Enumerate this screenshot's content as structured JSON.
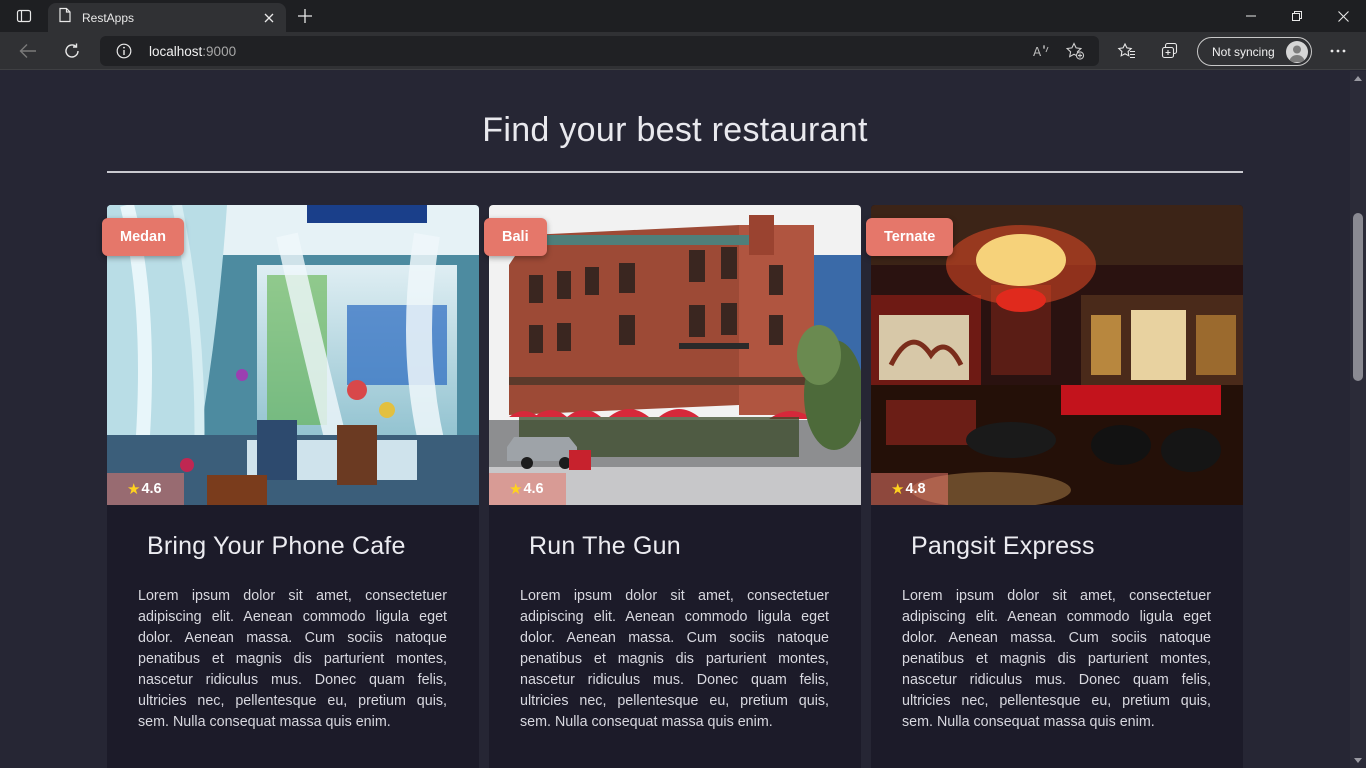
{
  "browser": {
    "tab_title": "RestApps",
    "url_host": "localhost",
    "url_port": ":9000",
    "sync_label": "Not syncing"
  },
  "page": {
    "heading": "Find your best restaurant",
    "accent_color": "#e5776a"
  },
  "restaurants": [
    {
      "city": "Medan",
      "rating": "4.6",
      "name": "Bring Your Phone Cafe",
      "description": "Lorem ipsum dolor sit amet, consectetuer adipiscing elit. Aenean commodo ligula eget dolor. Aenean massa. Cum sociis natoque penatibus et magnis dis parturient montes, nascetur ridiculus mus. Donec quam felis, ultricies nec, pellentesque eu, pretium quis, sem. Nulla consequat massa quis enim."
    },
    {
      "city": "Bali",
      "rating": "4.6",
      "name": "Run The Gun",
      "description": "Lorem ipsum dolor sit amet, consectetuer adipiscing elit. Aenean commodo ligula eget dolor. Aenean massa. Cum sociis natoque penatibus et magnis dis parturient montes, nascetur ridiculus mus. Donec quam felis, ultricies nec, pellentesque eu, pretium quis, sem. Nulla consequat massa quis enim."
    },
    {
      "city": "Ternate",
      "rating": "4.8",
      "name": "Pangsit Express",
      "description": "Lorem ipsum dolor sit amet, consectetuer adipiscing elit. Aenean commodo ligula eget dolor. Aenean massa. Cum sociis natoque penatibus et magnis dis parturient montes, nascetur ridiculus mus. Donec quam felis, ultricies nec, pellentesque eu, pretium quis, sem. Nulla consequat massa quis enim."
    }
  ]
}
